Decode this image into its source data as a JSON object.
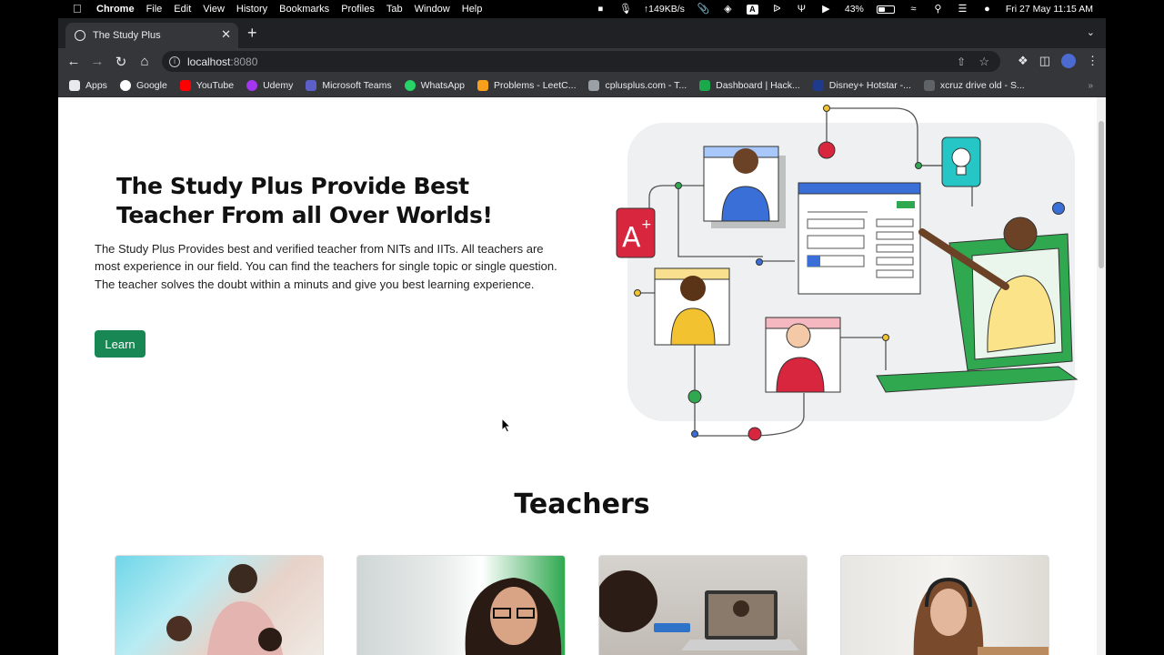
{
  "menubar": {
    "app_name": "Chrome",
    "menus": [
      "File",
      "Edit",
      "View",
      "History",
      "Bookmarks",
      "Profiles",
      "Tab",
      "Window",
      "Help"
    ],
    "network_speed": "149KB/s",
    "battery": "43%",
    "battery_level": 0.43,
    "datetime": "Fri 27 May  11:15 AM"
  },
  "browser": {
    "tab_title": "The Study Plus",
    "url_host": "localhost",
    "url_port": ":8080",
    "bookmarks": [
      {
        "label": "Apps",
        "color": "#e8eaed"
      },
      {
        "label": "Google",
        "color": "#ffffff"
      },
      {
        "label": "YouTube",
        "color": "#ff0000"
      },
      {
        "label": "Udemy",
        "color": "#a435f0"
      },
      {
        "label": "Microsoft Teams",
        "color": "#5b5fc7"
      },
      {
        "label": "WhatsApp",
        "color": "#25d366"
      },
      {
        "label": "Problems - LeetC...",
        "color": "#f89f1b"
      },
      {
        "label": "cplusplus.com - T...",
        "color": "#9aa0a6"
      },
      {
        "label": "Dashboard | Hack...",
        "color": "#1ba94c"
      },
      {
        "label": "Disney+ Hotstar -...",
        "color": "#1f3a8a"
      },
      {
        "label": "xcruz drive old - S...",
        "color": "#5f6368"
      }
    ]
  },
  "hero": {
    "title": "The Study Plus Provide Best Teacher From all Over Worlds!",
    "description": "The Study Plus Provides best and verified teacher from NITs and IITs. All teachers are most experience in our field. You can find the teachers for single topic or single question. The teacher solves the doubt within a minuts and give you best learning experience.",
    "button_label": "Learn",
    "button_color": "#198754"
  },
  "teachers": {
    "heading": "Teachers"
  },
  "colors": {
    "accent_green": "#198754",
    "illus_red": "#d7263d",
    "illus_blue": "#3a6fd8",
    "illus_green": "#2fa84f",
    "illus_yellow": "#f2c230",
    "illus_teal": "#26c6c6"
  }
}
